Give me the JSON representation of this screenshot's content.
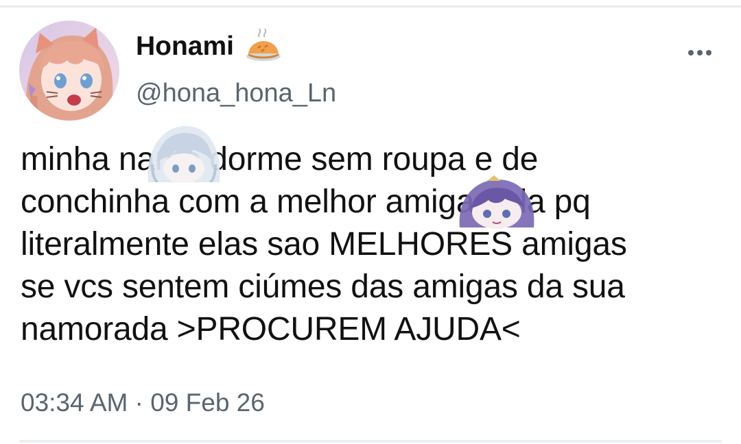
{
  "author": {
    "display_name": "Honami",
    "name_emoji": "pie-icon",
    "handle": "@hona_hona_Ln",
    "avatar": "anime-girl-avatar"
  },
  "tweet": {
    "text": "minha namo dorme sem roupa e de\nconchinha com a melhor amiga dela pq\nliteralmente elas sao MELHORES amigas\nse vcs sentem ciúmes das amigas da sua\nnamorada >PROCUREM AJUDA<",
    "timestamp": "03:34 AM · 09 Feb 26"
  },
  "menu": {
    "icon": "more-horizontal-icon"
  },
  "colors": {
    "text": "#111111",
    "secondary": "#59646e",
    "divider": "#e9ecee"
  }
}
